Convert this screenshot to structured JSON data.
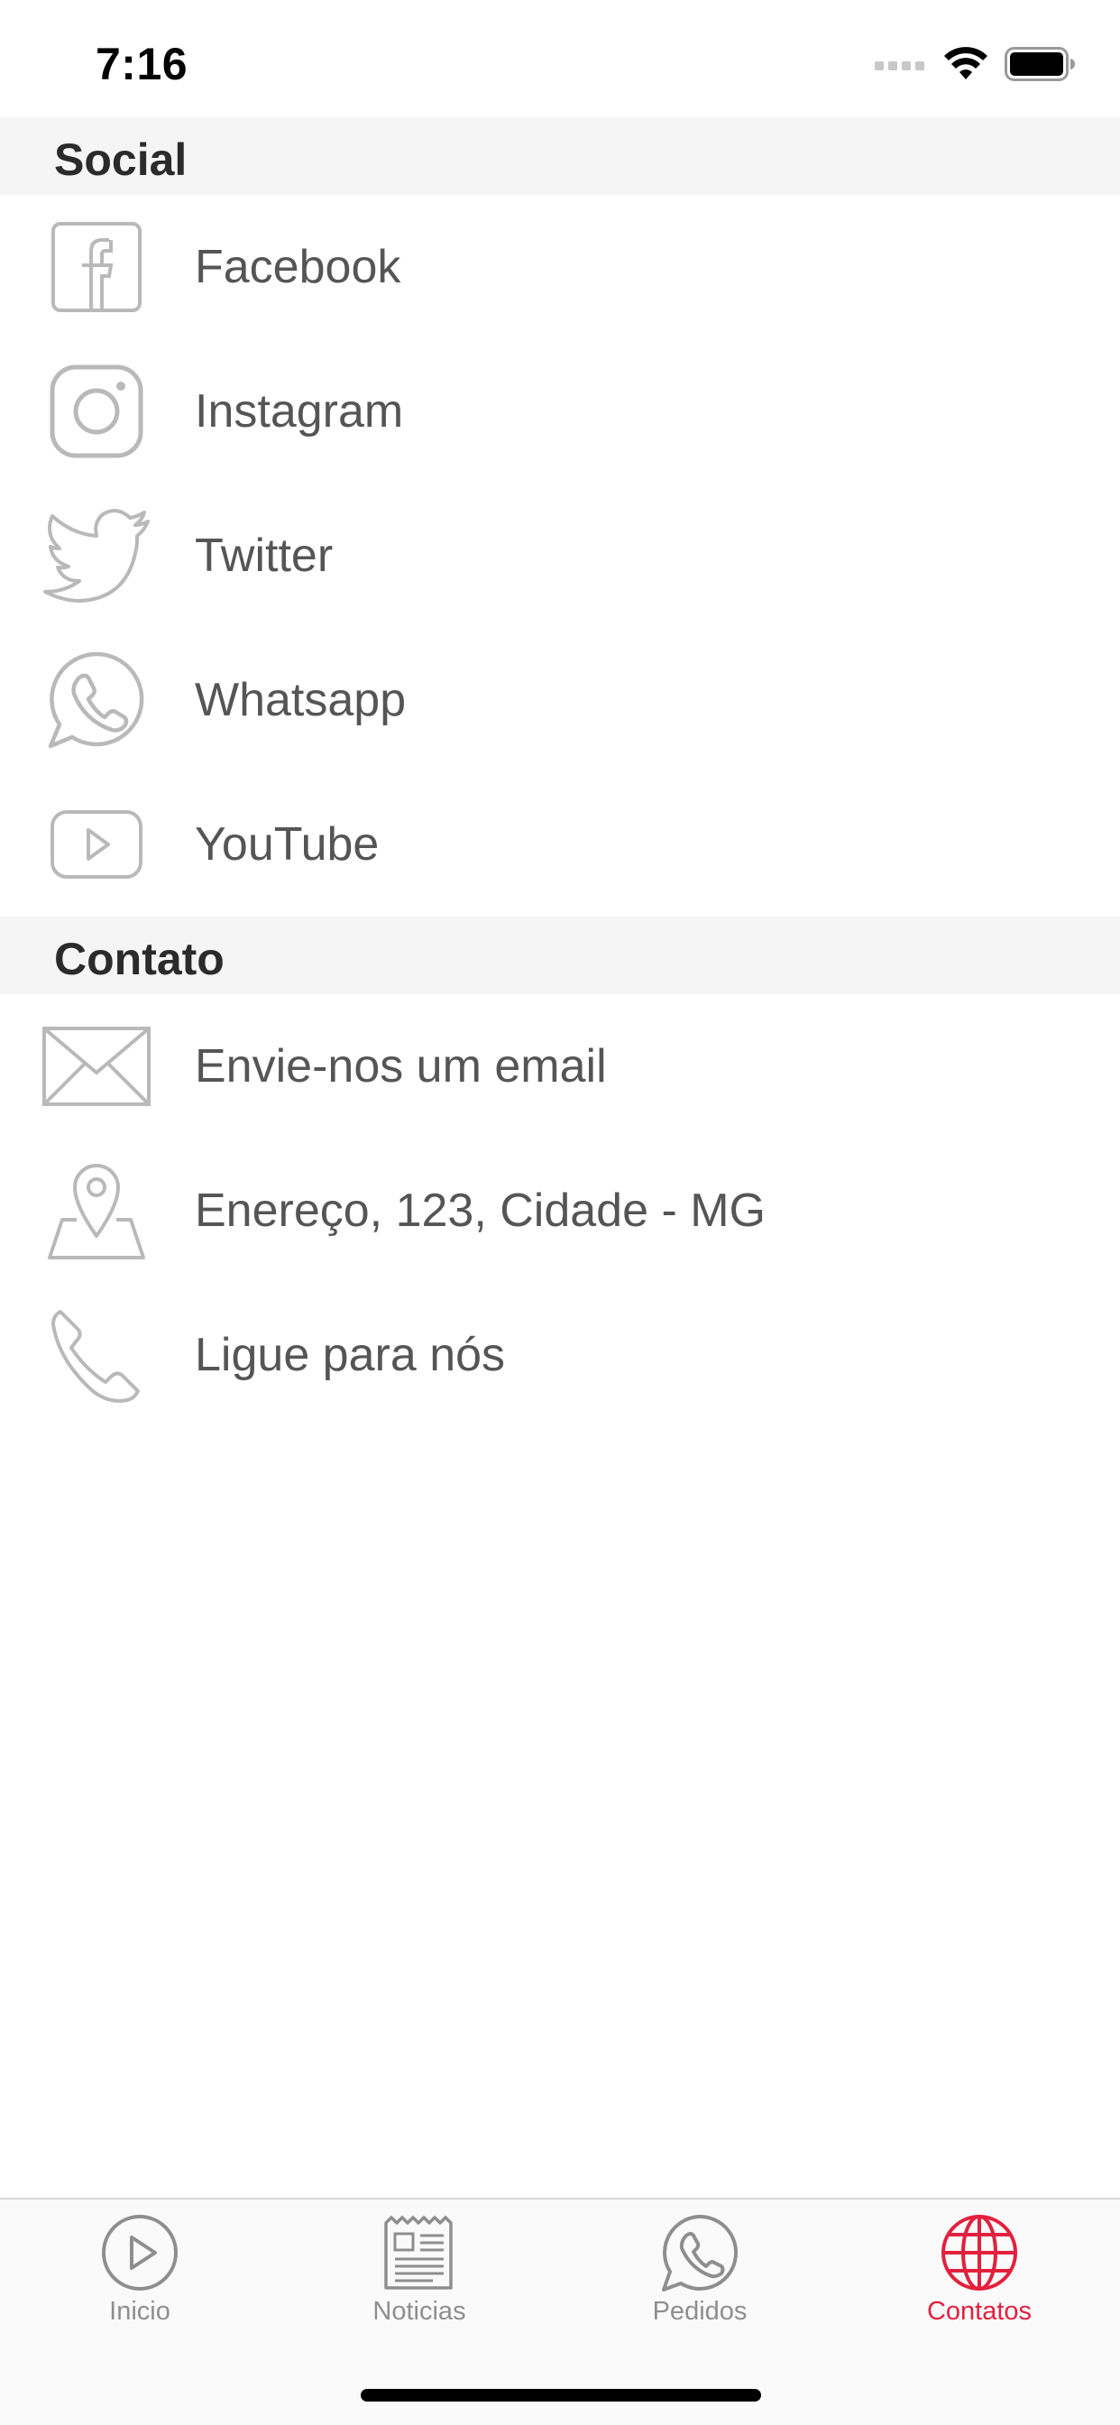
{
  "status_bar": {
    "time": "7:16"
  },
  "sections": {
    "social": {
      "title": "Social",
      "items": [
        {
          "label": "Facebook",
          "icon": "facebook-icon"
        },
        {
          "label": "Instagram",
          "icon": "instagram-icon"
        },
        {
          "label": "Twitter",
          "icon": "twitter-icon"
        },
        {
          "label": "Whatsapp",
          "icon": "whatsapp-icon"
        },
        {
          "label": "YouTube",
          "icon": "youtube-icon"
        }
      ]
    },
    "contato": {
      "title": "Contato",
      "items": [
        {
          "label": "Envie-nos um email",
          "icon": "envelope-icon"
        },
        {
          "label": "Enereço, 123, Cidade - MG",
          "icon": "map-pin-icon"
        },
        {
          "label": "Ligue para nós",
          "icon": "phone-icon"
        }
      ]
    }
  },
  "tab_bar": {
    "tabs": [
      {
        "label": "Inicio",
        "icon": "play-circle-icon",
        "active": false
      },
      {
        "label": "Noticias",
        "icon": "newspaper-icon",
        "active": false
      },
      {
        "label": "Pedidos",
        "icon": "whatsapp-icon",
        "active": false
      },
      {
        "label": "Contatos",
        "icon": "globe-icon",
        "active": true
      }
    ]
  },
  "colors": {
    "accent": "#e3203d",
    "icon_gray": "#b9b9b9",
    "label_gray": "#555555",
    "section_bg": "#f5f5f5"
  }
}
